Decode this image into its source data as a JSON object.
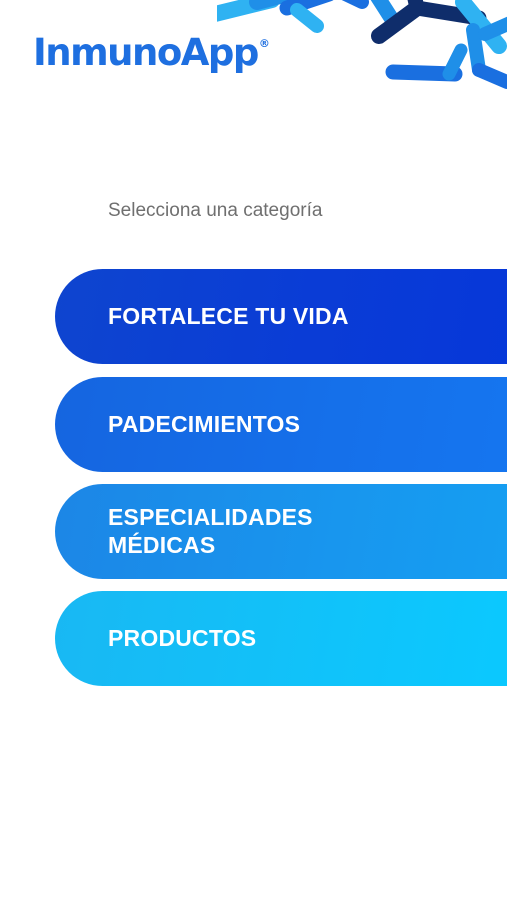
{
  "header": {
    "logo_text": "InmunoApp",
    "logo_mark": "®",
    "decoration_icon": "antibody-pattern-icon"
  },
  "prompt": "Selecciona una categoría",
  "categories": [
    {
      "label": "FORTALECE TU VIDA"
    },
    {
      "label": "PADECIMIENTOS"
    },
    {
      "label": "ESPECIALIDADES\nMÉDICAS"
    },
    {
      "label": "PRODUCTOS"
    }
  ],
  "colors": {
    "brand": "#1e6fe0",
    "category_1": "#0a3cd6",
    "category_2": "#1570ea",
    "category_3": "#1896ee",
    "category_4": "#10c3fa",
    "prompt_text": "#6f6f6f"
  }
}
